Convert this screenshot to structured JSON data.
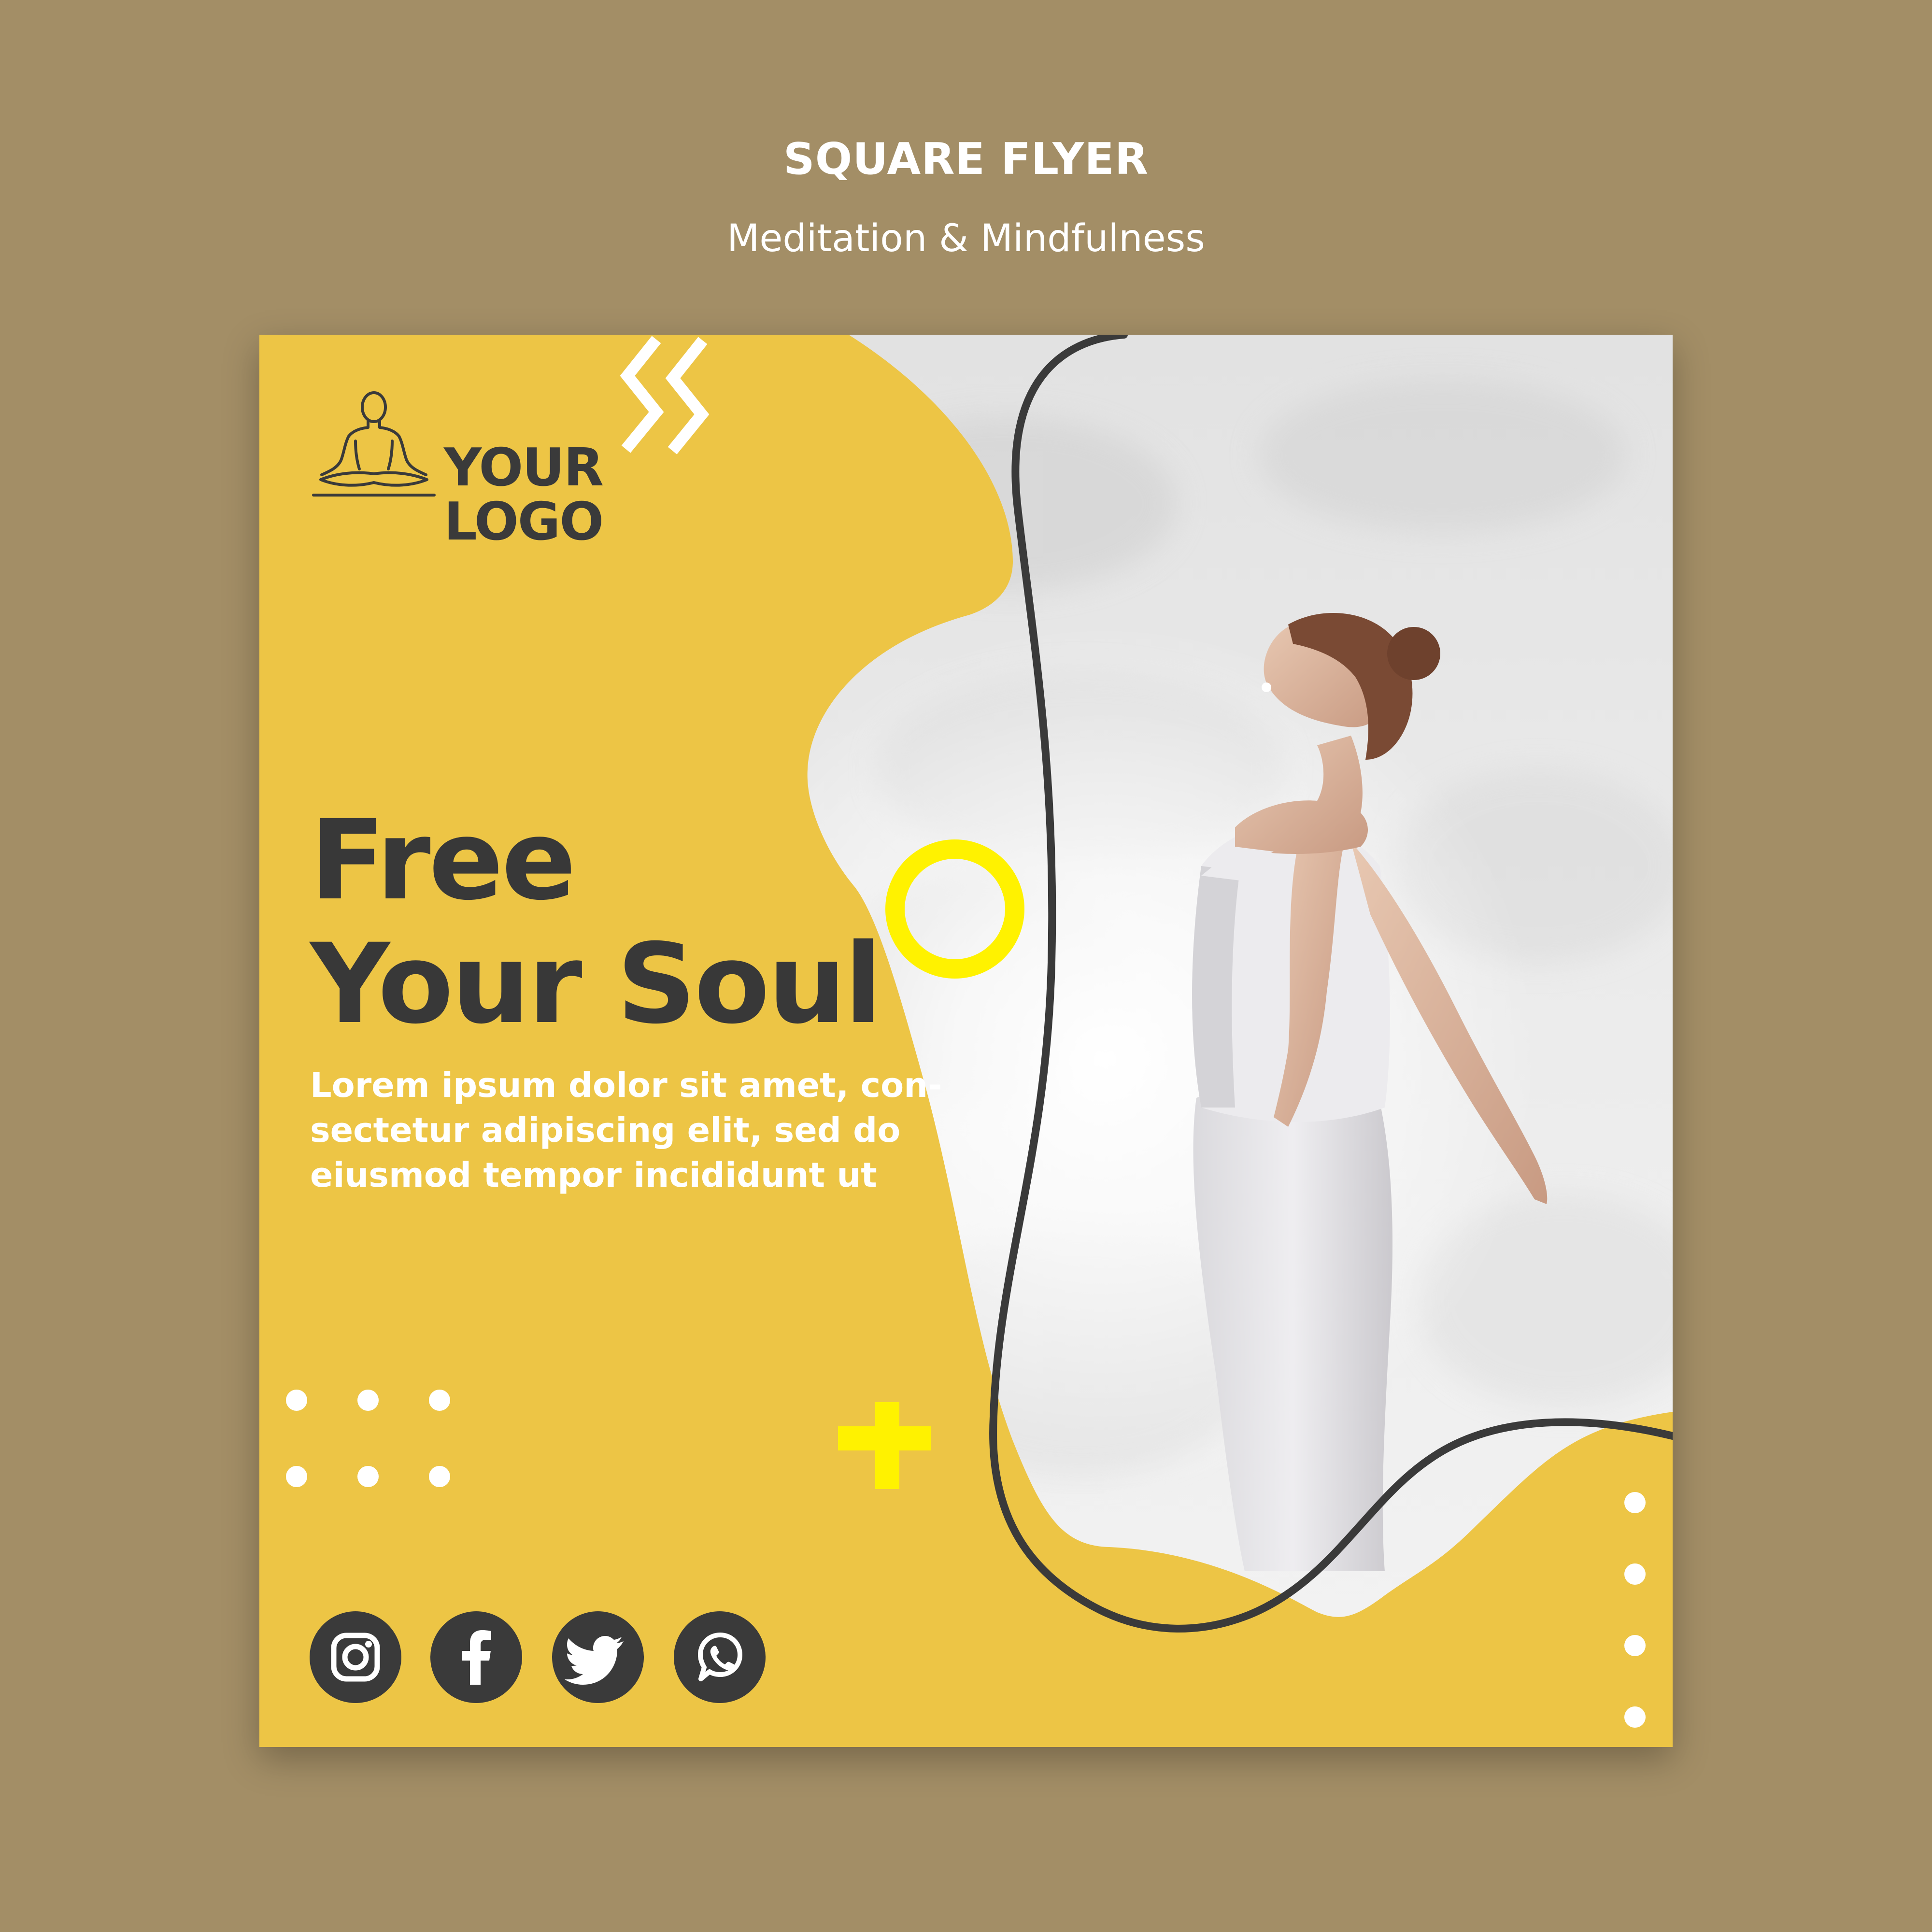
{
  "header": {
    "title": "SQUARE FLYER",
    "subtitle": "Meditation & Mindfulness"
  },
  "flyer": {
    "logo": {
      "icon": "meditation-figure-icon",
      "line1": "YOUR",
      "line2": "LOGO"
    },
    "headline": {
      "line1": "Free",
      "line2": "Your Soul"
    },
    "body": {
      "line1": "Lorem ipsum dolor sit amet, con-",
      "line2": "sectetur adipiscing elit, sed do",
      "line3": "eiusmod tempor incididunt ut"
    },
    "social_icons": [
      "instagram-icon",
      "facebook-icon",
      "twitter-icon",
      "whatsapp-icon"
    ],
    "photo": "woman-meditating-outdoors-photo"
  },
  "colors": {
    "page_background": "#a38e66",
    "flyer_yellow": "#edc545",
    "dark_gray": "#3a3a3a",
    "bright_yellow_accent": "#fff200",
    "white": "#ffffff"
  }
}
